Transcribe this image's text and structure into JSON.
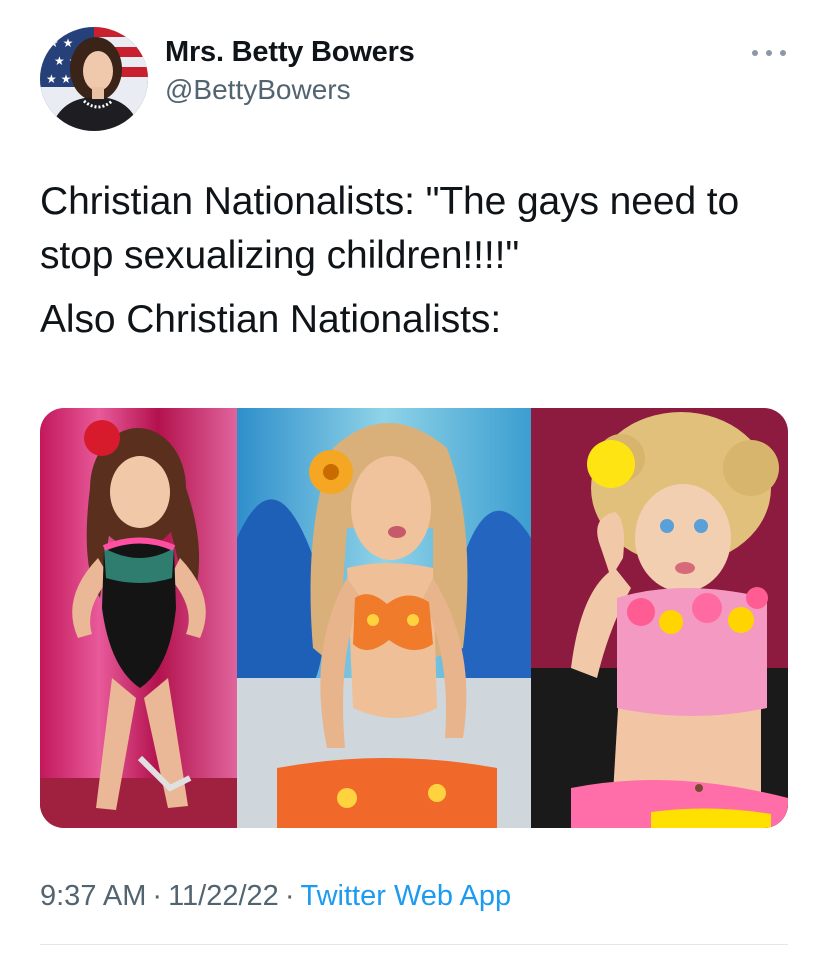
{
  "author": {
    "display_name": "Mrs. Betty Bowers",
    "handle": "@BettyBowers",
    "avatar_icon": "profile-photo"
  },
  "more_icon": "more-options-icon",
  "tweet": {
    "line1": "Christian Nationalists: \"The gays need to stop sexualizing children!!!!\"",
    "line2": "Also Christian Nationalists:"
  },
  "meta": {
    "time": "9:37 AM",
    "separator": "·",
    "date": "11/22/22",
    "source": "Twitter Web App"
  },
  "colors": {
    "text": "#0f1419",
    "secondary": "#536471",
    "link": "#1d9bf0",
    "divider": "#e1e8ed"
  }
}
